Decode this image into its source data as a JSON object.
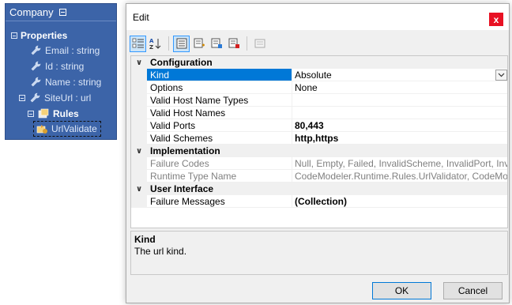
{
  "entity": {
    "title": "Company",
    "properties_label": "Properties",
    "properties": [
      {
        "label": "Email : string"
      },
      {
        "label": "Id : string"
      },
      {
        "label": "Name : string"
      },
      {
        "label": "SiteUrl : url"
      }
    ],
    "rules_label": "Rules",
    "validator_label": "UrlValidate"
  },
  "dialog": {
    "title": "Edit",
    "close_glyph": "x",
    "ok_label": "OK",
    "cancel_label": "Cancel"
  },
  "grid": {
    "categories": [
      {
        "name": "Configuration",
        "props": [
          {
            "name": "Kind",
            "value": "Absolute"
          },
          {
            "name": "Options",
            "value": "None"
          },
          {
            "name": "Valid Host Name Types",
            "value": ""
          },
          {
            "name": "Valid Host Names",
            "value": ""
          },
          {
            "name": "Valid Ports",
            "value": "80,443"
          },
          {
            "name": "Valid Schemes",
            "value": "http,https"
          }
        ]
      },
      {
        "name": "Implementation",
        "props": [
          {
            "name": "Failure Codes",
            "value": "Null, Empty, Failed, InvalidScheme, InvalidPort, InvalidHo"
          },
          {
            "name": "Runtime Type Name",
            "value": "CodeModeler.Runtime.Rules.UrlValidator, CodeModeler.R"
          }
        ]
      },
      {
        "name": "User Interface",
        "props": [
          {
            "name": "Failure Messages",
            "value": "(Collection)"
          }
        ]
      }
    ]
  },
  "description": {
    "title": "Kind",
    "text": "The url kind."
  },
  "colors": {
    "panel": "#3c64a8",
    "selection": "#0078d7",
    "close": "#e81123"
  }
}
